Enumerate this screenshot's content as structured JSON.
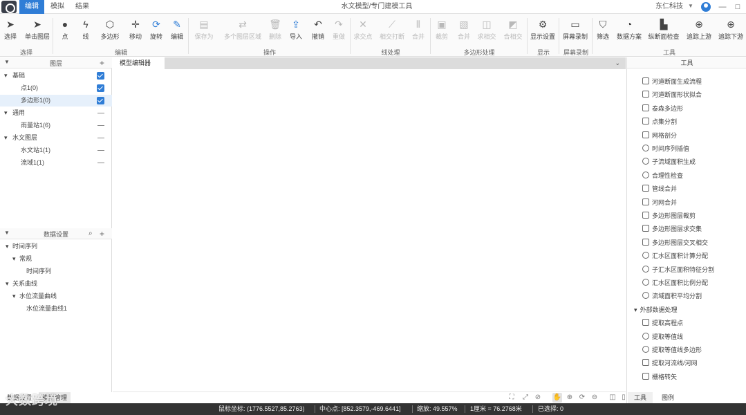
{
  "app": {
    "title": "水文模型/专门建模工具",
    "user": "东仁科技"
  },
  "top_tabs": [
    "编辑",
    "模拟",
    "结果"
  ],
  "window_buttons": [
    "—",
    "□"
  ],
  "ribbon": {
    "buttons": [
      {
        "label": "选择",
        "icon": "pointer"
      },
      {
        "label": "单击图层",
        "icon": "pointer-layer"
      },
      {
        "label": "点",
        "icon": "point"
      },
      {
        "label": "线",
        "icon": "line"
      },
      {
        "label": "多边形",
        "icon": "polygon"
      },
      {
        "label": "移动",
        "icon": "move"
      },
      {
        "label": "旋转",
        "icon": "rotate"
      },
      {
        "label": "编辑",
        "icon": "edit"
      },
      {
        "label": "保存为",
        "icon": "save-as"
      },
      {
        "label": "多个图层区域",
        "icon": "multi-layer"
      },
      {
        "label": "删除",
        "icon": "delete"
      },
      {
        "label": "导入",
        "icon": "import"
      },
      {
        "label": "撤销",
        "icon": "undo"
      },
      {
        "label": "重做",
        "icon": "redo"
      },
      {
        "label": "求交点",
        "icon": "intersect"
      },
      {
        "label": "相交打断",
        "icon": "split"
      },
      {
        "label": "合并",
        "icon": "merge"
      },
      {
        "label": "裁剪",
        "icon": "clip"
      },
      {
        "label": "合并",
        "icon": "merge2"
      },
      {
        "label": "求相交",
        "icon": "intersection"
      },
      {
        "label": "合相交",
        "icon": "combine"
      },
      {
        "label": "显示设置",
        "icon": "display-settings"
      },
      {
        "label": "屏幕录制",
        "icon": "screen-record"
      },
      {
        "label": "筛选",
        "icon": "filter"
      },
      {
        "label": "数据方案",
        "icon": "data-scheme"
      },
      {
        "label": "纵断面检查",
        "icon": "profile-check"
      },
      {
        "label": "追踪上游",
        "icon": "trace-up"
      },
      {
        "label": "追踪下游",
        "icon": "trace-down"
      }
    ],
    "groups": [
      "选择",
      "编辑",
      "操作",
      "线处理",
      "多边形处理",
      "显示",
      "屏幕录制",
      "工具"
    ]
  },
  "layers": {
    "title": "图层",
    "items": [
      {
        "label": "基础",
        "indent": 0,
        "expand": true,
        "checked": true
      },
      {
        "label": "点1(0)",
        "indent": 1,
        "checked": true
      },
      {
        "label": "多边形1(0)",
        "indent": 1,
        "checked": true,
        "selected": true
      },
      {
        "label": "通用",
        "indent": 0,
        "expand": true,
        "checked": false
      },
      {
        "label": "雨量站1(6)",
        "indent": 1,
        "checked": false
      },
      {
        "label": "水文图层",
        "indent": 0,
        "expand": true,
        "checked": false
      },
      {
        "label": "水文站1(1)",
        "indent": 1,
        "checked": false
      },
      {
        "label": "流域1(1)",
        "indent": 1,
        "checked": false
      }
    ]
  },
  "data": {
    "title": "数据设置",
    "items": [
      {
        "label": "时间序列",
        "indent": 0
      },
      {
        "label": "常规",
        "indent": 1
      },
      {
        "label": "时间序列",
        "indent": 2
      },
      {
        "label": "关系曲线",
        "indent": 0
      },
      {
        "label": "水位流量曲线",
        "indent": 1
      },
      {
        "label": "水位流量曲线1",
        "indent": 2
      }
    ]
  },
  "left_tabs": [
    "数据设置",
    "模型管理"
  ],
  "map": {
    "tab": "模型编辑器",
    "dropdown": "⌄"
  },
  "map_toolbar": [
    "⛶",
    "⤢",
    "⊘",
    "⊡",
    "✋",
    "⊕",
    "⟳",
    "⊖",
    "◫",
    "▯"
  ],
  "tools": {
    "title": "工具",
    "items": [
      {
        "label": "河道断面生成流程",
        "icon": "river-section-icon",
        "round": false
      },
      {
        "label": "河道断面形状拟合",
        "icon": "section-fit-icon",
        "round": false
      },
      {
        "label": "泰森多边形",
        "icon": "thiessen-icon",
        "round": false
      },
      {
        "label": "点集分割",
        "icon": "point-split-icon",
        "round": false
      },
      {
        "label": "网格剖分",
        "icon": "grid-icon",
        "round": false
      },
      {
        "label": "时间序列插值",
        "icon": "timeseries-icon",
        "round": true
      },
      {
        "label": "子流域面积生成",
        "icon": "subbasin-icon",
        "round": true
      },
      {
        "label": "合理性检查",
        "icon": "check-icon",
        "round": true
      },
      {
        "label": "管线合并",
        "icon": "pipe-merge-icon",
        "round": false
      },
      {
        "label": "河网合并",
        "icon": "river-merge-icon",
        "round": false
      },
      {
        "label": "多边形图层裁剪",
        "icon": "poly-clip-icon",
        "round": false
      },
      {
        "label": "多边形图层求交集",
        "icon": "poly-intersect-icon",
        "round": false
      },
      {
        "label": "多边形图层交叉相交",
        "icon": "poly-cross-icon",
        "round": false
      },
      {
        "label": "汇水区面积计算分配",
        "icon": "catchment-calc-icon",
        "round": true
      },
      {
        "label": "子汇水区面积特征分割",
        "icon": "sub-catchment-icon",
        "round": true
      },
      {
        "label": "汇水区面积比例分配",
        "icon": "catchment-ratio-icon",
        "round": true
      },
      {
        "label": "流域面积平均分割",
        "icon": "basin-split-icon",
        "round": true
      },
      {
        "label": "外部数据处理",
        "icon": "external-data-icon",
        "round": false,
        "header": true
      },
      {
        "label": "提取高程点",
        "icon": "extract-elev-icon",
        "round": false
      },
      {
        "label": "提取等值线",
        "icon": "contour-icon",
        "round": true
      },
      {
        "label": "提取等值线多边形",
        "icon": "contour-poly-icon",
        "round": true
      },
      {
        "label": "提取河流线/河网",
        "icon": "river-extract-icon",
        "round": false
      },
      {
        "label": "栅格转矢",
        "icon": "raster-icon",
        "round": false
      }
    ]
  },
  "right_tabs": [
    "工具",
    "图例"
  ],
  "status": {
    "coords": "鼠标坐标: (1776.5527,85.2763)",
    "center": "中心点: [852.3579,-469.6441]",
    "zoom": "缩放: 49.557%",
    "scale": "1厘米 = 76.2768米",
    "selected": "已选择: 0"
  },
  "watermark": "大数跨境"
}
